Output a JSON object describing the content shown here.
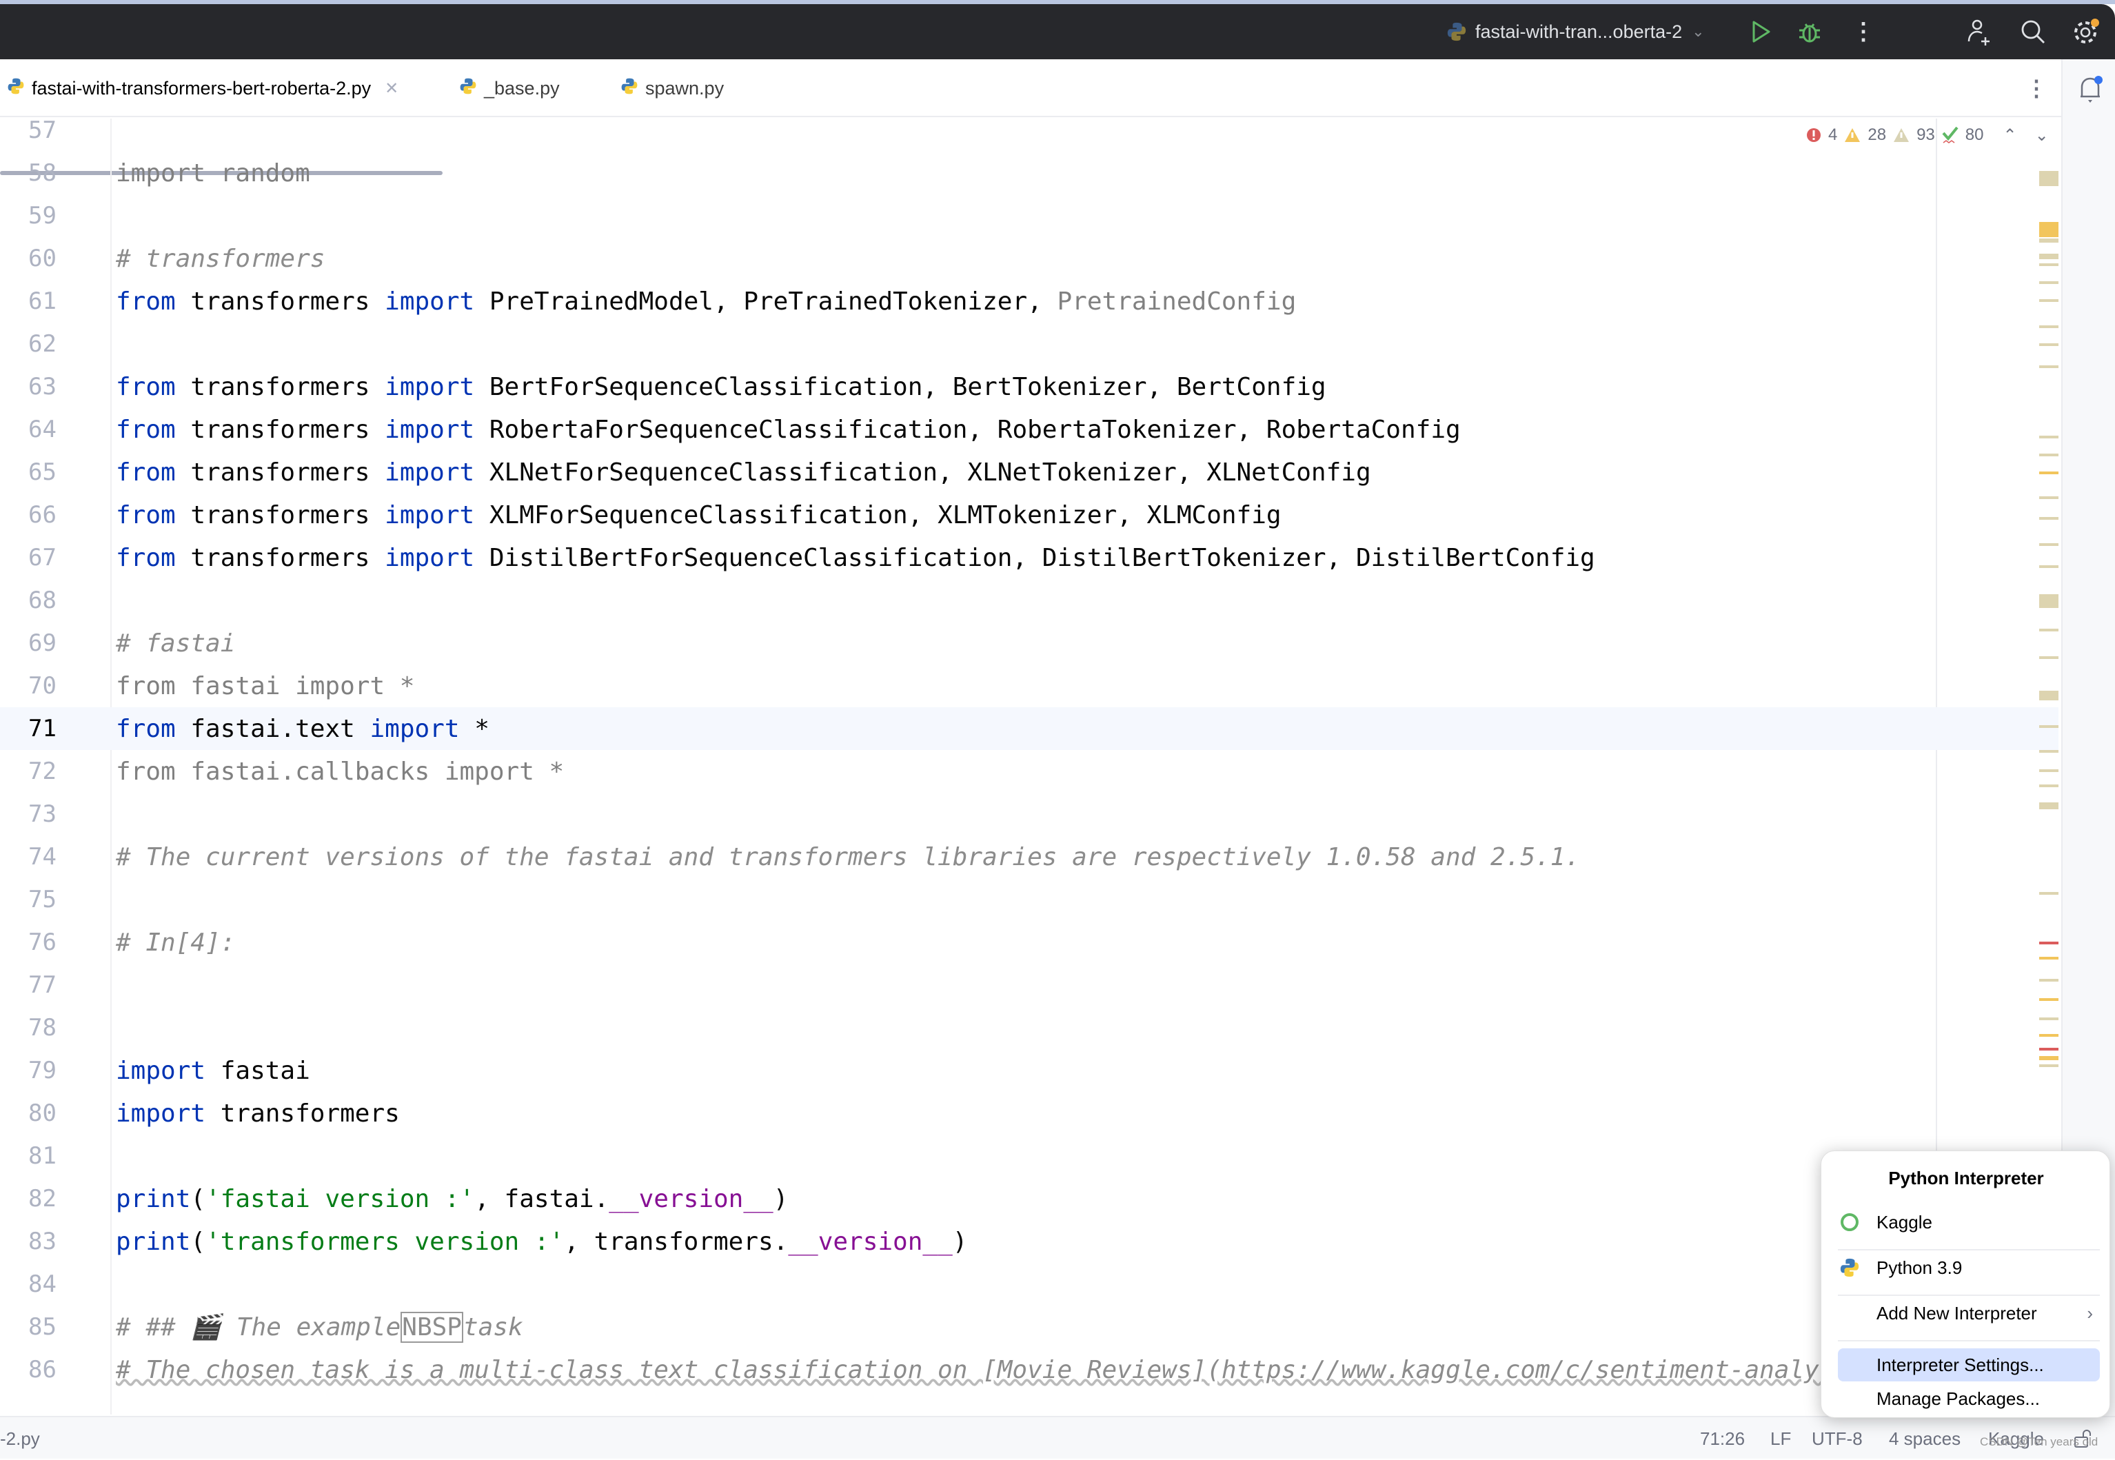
{
  "topbar": {
    "run_config": "fastai-with-tran...oberta-2",
    "icons": [
      "python-icon",
      "chevron-down-icon",
      "run-icon",
      "debug-icon",
      "more-icon",
      "add-user-icon",
      "search-icon",
      "settings-icon"
    ]
  },
  "tabs": [
    {
      "label": "fastai-with-transformers-bert-roberta-2.py",
      "active": true,
      "closable": true
    },
    {
      "label": "_base.py"
    },
    {
      "label": "spawn.py"
    }
  ],
  "inspections": {
    "errors": "4",
    "warnings": "28",
    "weak_warnings": "93",
    "typos": "80"
  },
  "editor": {
    "current_line": "71",
    "lines": [
      {
        "n": "57",
        "tokens": []
      },
      {
        "n": "58",
        "tokens": [
          [
            "un",
            "import random"
          ]
        ]
      },
      {
        "n": "59",
        "tokens": []
      },
      {
        "n": "60",
        "tokens": [
          [
            "cm",
            "# transformers"
          ]
        ]
      },
      {
        "n": "61",
        "tokens": [
          [
            "kw",
            "from"
          ],
          [
            "def",
            " transformers "
          ],
          [
            "kw",
            "import"
          ],
          [
            "def",
            " PreTrainedModel, PreTrainedTokenizer, "
          ],
          [
            "un",
            "PretrainedConfig"
          ]
        ]
      },
      {
        "n": "62",
        "tokens": []
      },
      {
        "n": "63",
        "tokens": [
          [
            "kw",
            "from"
          ],
          [
            "def",
            " transformers "
          ],
          [
            "kw",
            "import"
          ],
          [
            "def",
            " BertForSequenceClassification, BertTokenizer, BertConfig"
          ]
        ]
      },
      {
        "n": "64",
        "tokens": [
          [
            "kw",
            "from"
          ],
          [
            "def",
            " transformers "
          ],
          [
            "kw",
            "import"
          ],
          [
            "def",
            " RobertaForSequenceClassification, RobertaTokenizer, RobertaConfig"
          ]
        ]
      },
      {
        "n": "65",
        "tokens": [
          [
            "kw",
            "from"
          ],
          [
            "def",
            " transformers "
          ],
          [
            "kw",
            "import"
          ],
          [
            "def",
            " XLNetForSequenceClassification, XLNetTokenizer, XLNetConfig"
          ]
        ]
      },
      {
        "n": "66",
        "tokens": [
          [
            "kw",
            "from"
          ],
          [
            "def",
            " transformers "
          ],
          [
            "kw",
            "import"
          ],
          [
            "def",
            " XLMForSequenceClassification, XLMTokenizer, XLMConfig"
          ]
        ]
      },
      {
        "n": "67",
        "tokens": [
          [
            "kw",
            "from"
          ],
          [
            "def",
            " transformers "
          ],
          [
            "kw",
            "import"
          ],
          [
            "def",
            " DistilBertForSequenceClassification, DistilBertTokenizer, DistilBertConfig"
          ]
        ]
      },
      {
        "n": "68",
        "tokens": []
      },
      {
        "n": "69",
        "tokens": [
          [
            "cm",
            "# fastai"
          ]
        ]
      },
      {
        "n": "70",
        "tokens": [
          [
            "un",
            "from fastai import *"
          ]
        ]
      },
      {
        "n": "71",
        "tokens": [
          [
            "kw",
            "from"
          ],
          [
            "def",
            " fastai.text "
          ],
          [
            "kw",
            "import"
          ],
          [
            "def",
            " *"
          ]
        ]
      },
      {
        "n": "72",
        "tokens": [
          [
            "un",
            "from fastai.callbacks import *"
          ]
        ]
      },
      {
        "n": "73",
        "tokens": []
      },
      {
        "n": "74",
        "tokens": [
          [
            "cm",
            "# The current versions of the fastai and transformers libraries are respectively 1.0.58 and 2.5.1."
          ]
        ]
      },
      {
        "n": "75",
        "tokens": []
      },
      {
        "n": "76",
        "tokens": [
          [
            "cm",
            "# In[4]:"
          ]
        ]
      },
      {
        "n": "77",
        "tokens": []
      },
      {
        "n": "78",
        "tokens": []
      },
      {
        "n": "79",
        "tokens": [
          [
            "kw",
            "import"
          ],
          [
            "def",
            " fastai"
          ]
        ]
      },
      {
        "n": "80",
        "tokens": [
          [
            "kw",
            "import"
          ],
          [
            "def",
            " transformers"
          ]
        ]
      },
      {
        "n": "81",
        "tokens": []
      },
      {
        "n": "82",
        "tokens": [
          [
            "kw",
            "print"
          ],
          [
            "def",
            "("
          ],
          [
            "str",
            "'fastai version :'"
          ],
          [
            "def",
            ", fastai."
          ],
          [
            "dun",
            "__version__"
          ],
          [
            "def",
            ")"
          ]
        ]
      },
      {
        "n": "83",
        "tokens": [
          [
            "kw",
            "print"
          ],
          [
            "def",
            "("
          ],
          [
            "str",
            "'transformers version :'"
          ],
          [
            "def",
            ", transformers."
          ],
          [
            "dun",
            "__version__"
          ],
          [
            "def",
            ")"
          ]
        ]
      },
      {
        "n": "84",
        "tokens": []
      },
      {
        "n": "85",
        "tokens": [
          [
            "cm",
            "# ## 🎬 The example"
          ],
          [
            "nbsp",
            "NBSP"
          ],
          [
            "cm",
            "task"
          ]
        ]
      },
      {
        "n": "86",
        "tokens": [
          [
            "cm wavy",
            "# The chosen task is a multi-class text classification on [Movie Reviews](https://www.kaggle.com/c/sentiment-analysis-on-movie-reviews)"
          ]
        ]
      }
    ]
  },
  "popup": {
    "title": "Python Interpreter",
    "items": [
      {
        "label": "Kaggle",
        "icon": "kaggle-icon"
      },
      {
        "label": "Python 3.9",
        "icon": "python-icon"
      },
      {
        "label": "Add New Interpreter",
        "submenu": true
      },
      {
        "label": "Interpreter Settings...",
        "highlighted": true
      },
      {
        "label": "Manage Packages..."
      }
    ]
  },
  "status": {
    "file": "-2.py",
    "position": "71:26",
    "line_sep": "LF",
    "encoding": "UTF-8",
    "indent": "4 spaces",
    "interpreter": "Kaggle"
  },
  "watermark": "CSDN @Ten years old",
  "colors": {
    "keyword": "#0033b3",
    "string": "#067d17",
    "dunder": "#871094",
    "comment": "#8c8c8c",
    "error": "#db5c5c",
    "warning": "#f2c55c",
    "selection": "#d5e1ff"
  }
}
